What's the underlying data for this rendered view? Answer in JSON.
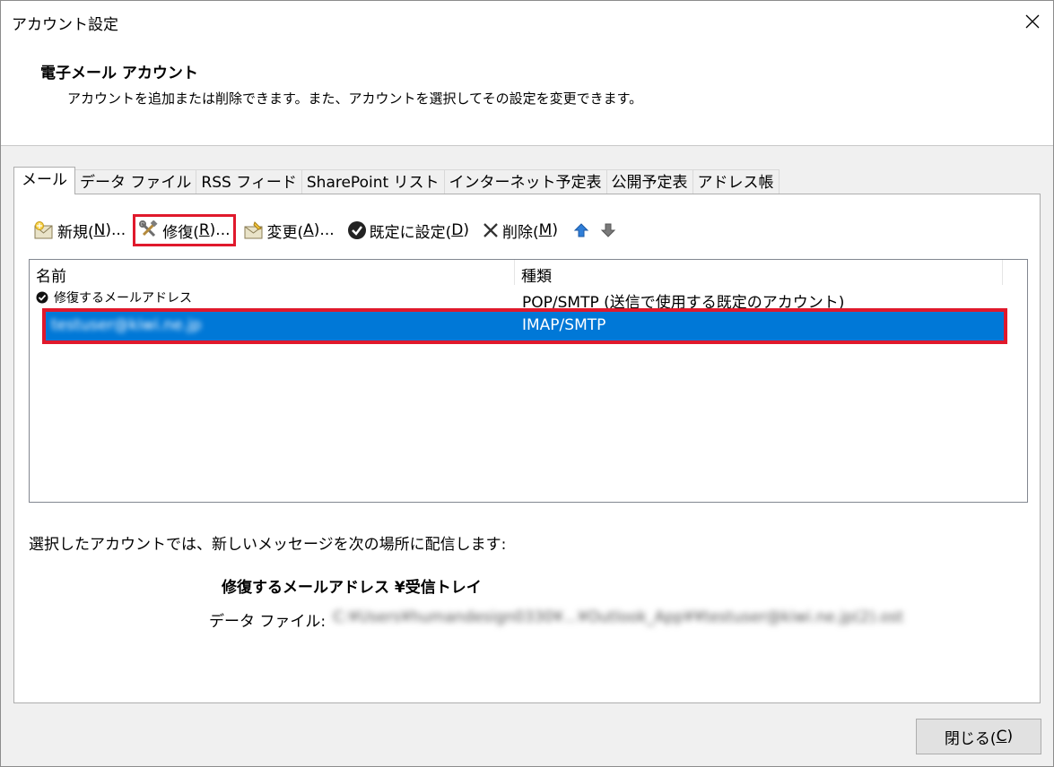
{
  "window": {
    "title": "アカウント設定",
    "close_glyph": "✕"
  },
  "header": {
    "title": "電子メール アカウント",
    "description": "アカウントを追加または削除できます。また、アカウントを選択してその設定を変更できます。"
  },
  "tabs": [
    {
      "label": "メール",
      "active": true
    },
    {
      "label": "データ ファイル"
    },
    {
      "label": "RSS フィード"
    },
    {
      "label": "SharePoint リスト"
    },
    {
      "label": "インターネット予定表"
    },
    {
      "label": "公開予定表"
    },
    {
      "label": "アドレス帳"
    }
  ],
  "toolbar": {
    "new": {
      "label": "新規(",
      "key": "N",
      "suffix": ")..."
    },
    "repair": {
      "label": "修復(",
      "key": "R",
      "suffix": ")..."
    },
    "change": {
      "label": "変更(",
      "key": "A",
      "suffix": ")..."
    },
    "set_default": {
      "label": "既定に設定(",
      "key": "D",
      "suffix": ")"
    },
    "delete": {
      "label": "削除(",
      "key": "M",
      "suffix": ")"
    }
  },
  "accounts_list": {
    "columns": {
      "name": "名前",
      "type": "種類"
    },
    "rows": [
      {
        "name": "修復するメールアドレス",
        "type": "POP/SMTP (送信で使用する既定のアカウント)",
        "default": true
      },
      {
        "name_prefix": "testuser@",
        "name_blurred": "kiwi.ne.jp",
        "type": "IMAP/SMTP",
        "selected": true
      }
    ]
  },
  "delivery": {
    "description": "選択したアカウントでは、新しいメッセージを次の場所に配信します:",
    "folder": "修復するメールアドレス ¥受信トレイ",
    "data_file_label": "データ ファイル:",
    "data_file_path": "C:¥Users¥humandesign0330¥...¥Outlook_App¥¥testuser@kiwi.ne.jp(2).ost"
  },
  "close_button": {
    "label": "閉じる(",
    "key": "C",
    "suffix": ")"
  }
}
